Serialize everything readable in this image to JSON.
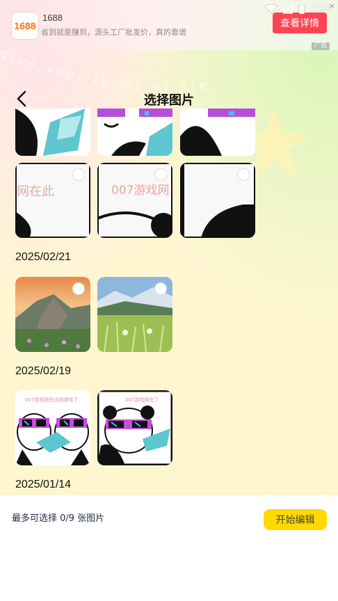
{
  "status_bar": {
    "time": "3:08"
  },
  "ad": {
    "logo_text": "1688",
    "title": "1688",
    "description": "省到就是赚到，源头工厂批发价，真的靠谱",
    "button_label": "查看详情",
    "tag": "广告",
    "close_symbol": "×"
  },
  "background": {
    "deco_text": "give your forms of pre"
  },
  "header": {
    "title": "选择图片",
    "back_symbol": "back"
  },
  "groups": [
    {
      "date": "",
      "images": [
        "panda-partial-1",
        "panda-partial-2",
        "panda-partial-3",
        "watermark-partial-1",
        "watermark-partial-2",
        "watermark-partial-3"
      ]
    },
    {
      "date": "2025/02/21",
      "images": [
        "mountain-sunset",
        "mountain-meadow"
      ]
    },
    {
      "date": "2025/02/19",
      "images": [
        "panda-double",
        "panda-single"
      ]
    },
    {
      "date": "2025/01/14",
      "images": []
    }
  ],
  "watermark_text": {
    "partial_a": "网在此",
    "partial_b": "007游戏网",
    "thumb_a": "007游戏网在这网游戏下",
    "thumb_b": "007游戏网在了"
  },
  "bottom": {
    "selection_text": "最多可选择 0/9 张图片",
    "start_button": "开始编辑"
  },
  "colors": {
    "accent": "#ffd900",
    "ad_button": "#ff3b4e"
  }
}
